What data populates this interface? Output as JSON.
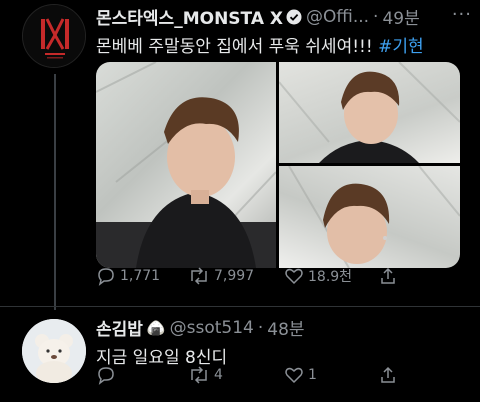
{
  "tweet": {
    "author_name": "몬스타엑스_MONSTA X",
    "handle": "@Offi...",
    "dot": "·",
    "time": "49분",
    "more": "···",
    "text": "몬베베 주말동안 집에서 푸욱 쉬세여!!!",
    "hashtag": "#기현",
    "counts": {
      "replies": "1,771",
      "retweets": "7,997",
      "likes": "18.9천"
    }
  },
  "reply": {
    "author_name": "손김밥",
    "name_emoji": "🍙",
    "handle": "@ssot514",
    "dot": "·",
    "time": "48분",
    "text": "지금 일요일 8신디",
    "counts": {
      "replies": "",
      "retweets": "4",
      "likes": "1"
    }
  },
  "icons": {
    "verified": "verified-badge-icon",
    "reply": "reply-bubble-icon",
    "retweet": "retweet-arrows-icon",
    "like": "heart-icon",
    "share": "share-upload-icon"
  },
  "colors": {
    "background": "#000000",
    "link": "#3ea0f0",
    "muted": "#8b9096",
    "verified": "#e7e9ea"
  }
}
